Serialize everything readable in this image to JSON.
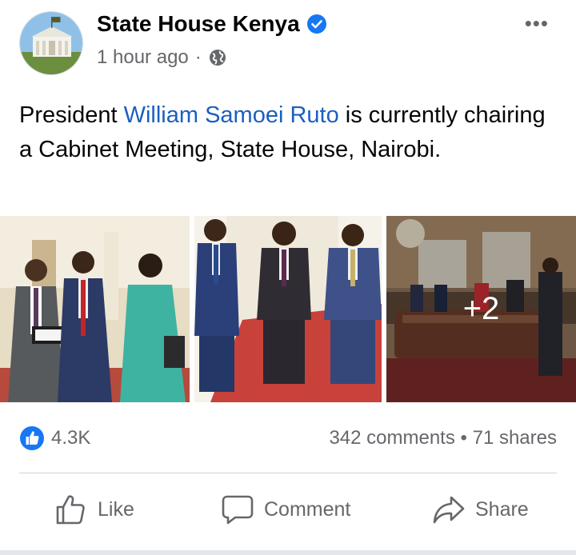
{
  "post": {
    "page_name": "State House Kenya",
    "timestamp": "1 hour ago",
    "separator": "·",
    "audience_icon": "globe-icon",
    "verified_icon": "verified-badge-icon",
    "more_icon": "•••",
    "text_before": "President ",
    "mention": "William Samoei Ruto",
    "text_after": " is currently chairing a Cabinet Meeting, State House, Nairobi.",
    "more_photos": "+2"
  },
  "stats": {
    "reaction_icon": "like-icon",
    "likes": "4.3K",
    "comments": "342 comments",
    "dot": "•",
    "shares": "71 shares"
  },
  "actions": {
    "like": "Like",
    "comment": "Comment",
    "share": "Share"
  },
  "colors": {
    "accent": "#1877f2",
    "mention": "#1b5fc1",
    "secondary_text": "#65676b",
    "red_carpet": "#c9443c"
  }
}
